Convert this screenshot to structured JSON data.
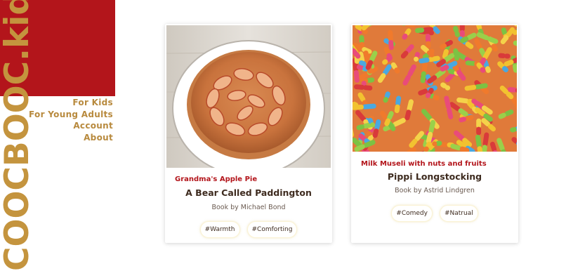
{
  "logo": {
    "brand": "COOCBOOC",
    "tld": ".kids",
    "color": "#b3151b"
  },
  "nav": {
    "items": [
      {
        "label": "For Kids"
      },
      {
        "label": "For Young Adults"
      },
      {
        "label": "Account"
      },
      {
        "label": "About"
      }
    ]
  },
  "cards": [
    {
      "image": "apple-pie-photo",
      "subtitle": "Grandma's Apple Pie",
      "title": "A Bear Called Paddington",
      "author": "Book by Michael Bond",
      "tags": [
        "#Warmth",
        "#Comforting"
      ]
    },
    {
      "image": "gummy-worms-photo",
      "subtitle": "Milk Museli with nuts and fruits",
      "title": "Pippi Longstocking",
      "author": "Book by Astrid Lindgren",
      "tags": [
        "#Comedy",
        "#Natrual"
      ]
    }
  ]
}
